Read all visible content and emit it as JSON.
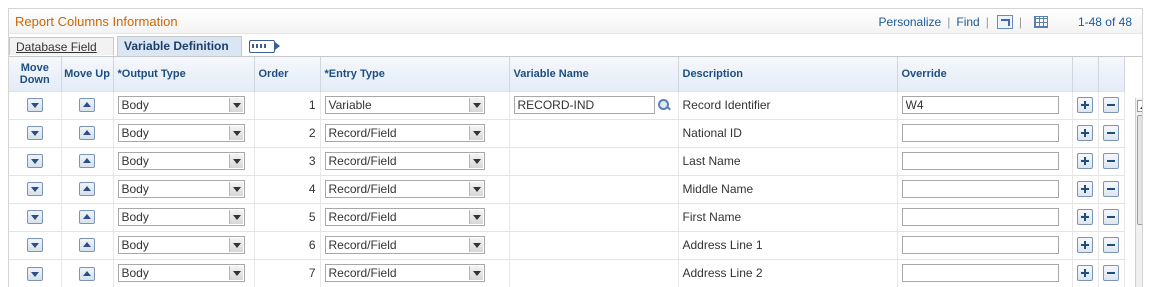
{
  "grid": {
    "title": "Report Columns Information",
    "personalize_label": "Personalize",
    "find_label": "Find",
    "separator": "|",
    "row_count": "1-48 of 48"
  },
  "tabs": [
    {
      "label": "Database Field",
      "active": false
    },
    {
      "label": "Variable Definition",
      "active": true
    }
  ],
  "columns": {
    "move_down": "Move Down",
    "move_up": "Move Up",
    "output_type": "*Output Type",
    "order": "Order",
    "entry_type": "*Entry Type",
    "variable_name": "Variable Name",
    "description": "Description",
    "override": "Override"
  },
  "rows": [
    {
      "output_type": "Body",
      "order": "1",
      "entry_type": "Variable",
      "variable_name": "RECORD-IND",
      "description": "Record Identifier",
      "override": "W4"
    },
    {
      "output_type": "Body",
      "order": "2",
      "entry_type": "Record/Field",
      "variable_name": "",
      "description": "National ID",
      "override": ""
    },
    {
      "output_type": "Body",
      "order": "3",
      "entry_type": "Record/Field",
      "variable_name": "",
      "description": "Last Name",
      "override": ""
    },
    {
      "output_type": "Body",
      "order": "4",
      "entry_type": "Record/Field",
      "variable_name": "",
      "description": "Middle Name",
      "override": ""
    },
    {
      "output_type": "Body",
      "order": "5",
      "entry_type": "Record/Field",
      "variable_name": "",
      "description": "First Name",
      "override": ""
    },
    {
      "output_type": "Body",
      "order": "6",
      "entry_type": "Record/Field",
      "variable_name": "",
      "description": "Address Line 1",
      "override": ""
    },
    {
      "output_type": "Body",
      "order": "7",
      "entry_type": "Record/Field",
      "variable_name": "",
      "description": "Address Line 2",
      "override": ""
    }
  ],
  "icons": {
    "move_down": "arrow-down-icon",
    "move_up": "arrow-up-icon",
    "dropdown": "chevron-down-icon",
    "lookup": "search-icon",
    "add": "plus-icon",
    "delete": "minus-icon",
    "view_all": "new-window-icon",
    "download": "grid-icon",
    "show_all_columns": "show-all-columns-icon"
  },
  "colors": {
    "title": "#cc6600",
    "link": "#1d5a98",
    "header_text": "#1d4f82"
  }
}
